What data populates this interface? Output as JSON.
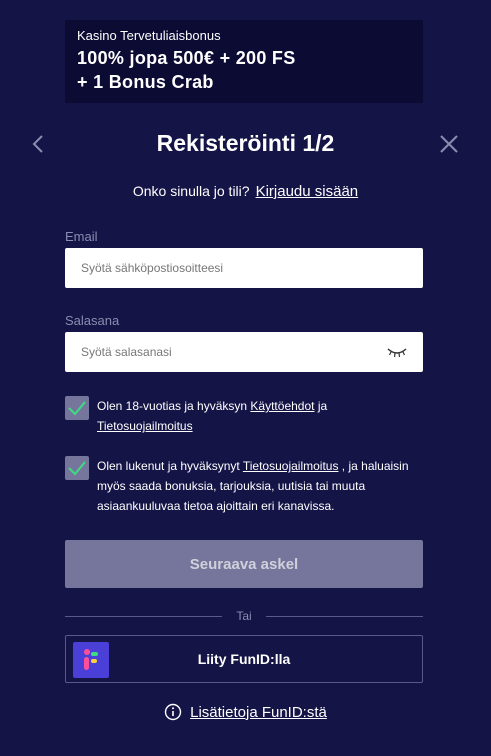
{
  "bonus": {
    "small": "Kasino Tervetuliaisbonus",
    "line1": "100% jopa 500€ + 200 FS",
    "line2": "+ 1 Bonus Crab"
  },
  "header": {
    "title": "Rekisteröinti 1/2"
  },
  "login": {
    "question": "Onko sinulla jo tili?",
    "link": "Kirjaudu sisään"
  },
  "email": {
    "label": "Email",
    "placeholder": "Syötä sähköpostiosoitteesi",
    "value": ""
  },
  "password": {
    "label": "Salasana",
    "placeholder": "Syötä salasanasi",
    "value": ""
  },
  "consent1": {
    "text_before": "Olen 18-vuotias ja hyväksyn ",
    "link1": "Käyttöehdot",
    "text_mid": " ja ",
    "link2": "Tietosuojailmoitus"
  },
  "consent2": {
    "text_before": "Olen lukenut ja hyväksynyt ",
    "link": "Tietosuojailmoitus",
    "text_after": " , ja haluaisin myös saada bonuksia, tarjouksia, uutisia tai muuta asiaankuuluvaa tietoa ajoittain eri kanavissa."
  },
  "next_button": "Seuraava askel",
  "divider": "Tai",
  "funid": {
    "label": "Liity FunID:lla"
  },
  "info": {
    "link": "Lisätietoja FunID:stä"
  },
  "colors": {
    "background": "#141446",
    "banner": "#0b0b33",
    "disabled_button": "#76769c",
    "checkbox_check": "#3ddc84",
    "funid_brand": "#4a3fd6"
  }
}
